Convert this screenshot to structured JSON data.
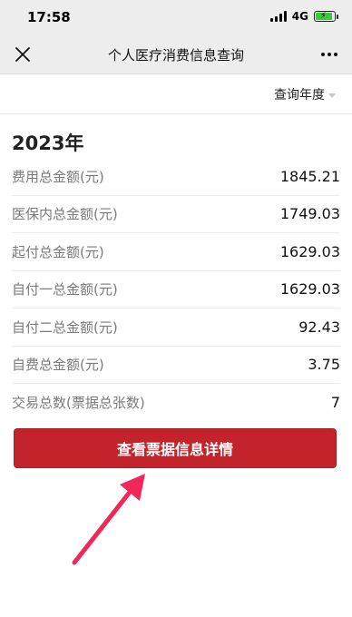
{
  "status_bar": {
    "time": "17:58",
    "network": "4G",
    "battery_color": "#3ec63e"
  },
  "nav": {
    "title": "个人医疗消费信息查询",
    "close_icon": "close-icon",
    "more_icon": "more-icon"
  },
  "filter": {
    "year_label": "查询年度"
  },
  "summary": {
    "year_heading": "2023年",
    "rows": [
      {
        "label": "费用总金额(元)",
        "value": "1845.21"
      },
      {
        "label": "医保内总金额(元)",
        "value": "1749.03"
      },
      {
        "label": "起付总金额(元)",
        "value": "1629.03"
      },
      {
        "label": "自付一总金额(元)",
        "value": "1629.03"
      },
      {
        "label": "自付二总金额(元)",
        "value": "92.43"
      },
      {
        "label": "自费总金额(元)",
        "value": "3.75"
      },
      {
        "label": "交易总数(票据总张数)",
        "value": "7"
      }
    ]
  },
  "actions": {
    "detail_button_label": "查看票据信息详情",
    "button_color": "#c3242b"
  },
  "annotation": {
    "arrow_color": "#f0285a"
  }
}
